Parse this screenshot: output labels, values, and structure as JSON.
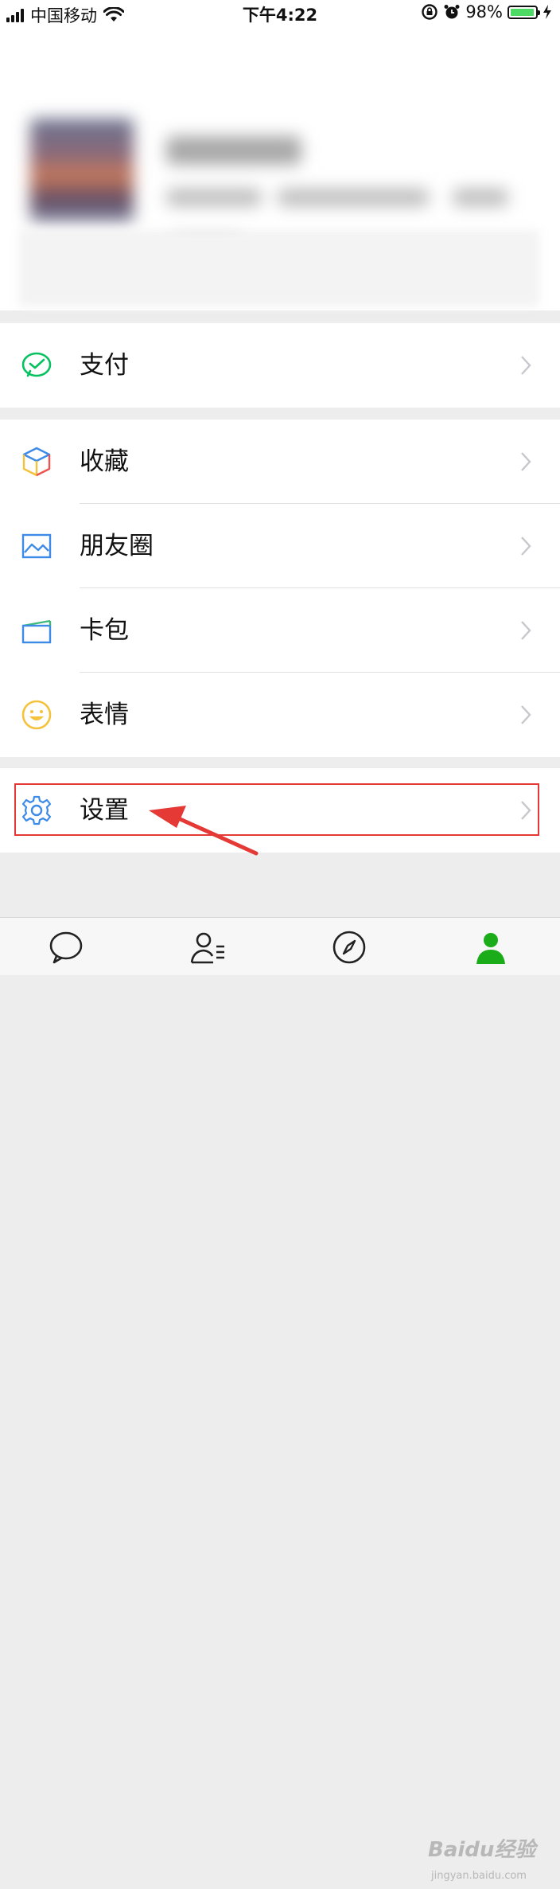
{
  "status_bar": {
    "carrier": "中国移动",
    "time": "下午4:22",
    "battery_percent": "98%",
    "battery_level": 0.98
  },
  "menu": {
    "pay": {
      "label": "支付",
      "icon": "wechat-pay-icon"
    },
    "favorites": {
      "label": "收藏",
      "icon": "cube-icon"
    },
    "moments": {
      "label": "朋友圈",
      "icon": "photo-icon"
    },
    "cards": {
      "label": "卡包",
      "icon": "card-wallet-icon"
    },
    "stickers": {
      "label": "表情",
      "icon": "smiley-icon"
    },
    "settings": {
      "label": "设置",
      "icon": "gear-icon"
    }
  },
  "tabbar": {
    "tabs": [
      {
        "name": "chats",
        "icon": "chat-bubble-icon",
        "active": false
      },
      {
        "name": "contacts",
        "icon": "contacts-icon",
        "active": false
      },
      {
        "name": "discover",
        "icon": "compass-icon",
        "active": false
      },
      {
        "name": "me",
        "icon": "person-icon",
        "active": true
      }
    ]
  },
  "watermark": {
    "logo": "Baidu经验",
    "url": "jingyan.baidu.com"
  },
  "colors": {
    "accent_green": "#1aad19",
    "pay_green": "#07c160",
    "highlight_red": "#e53935",
    "chevron": "#c7c7cc",
    "battery_green": "#4cd964"
  }
}
